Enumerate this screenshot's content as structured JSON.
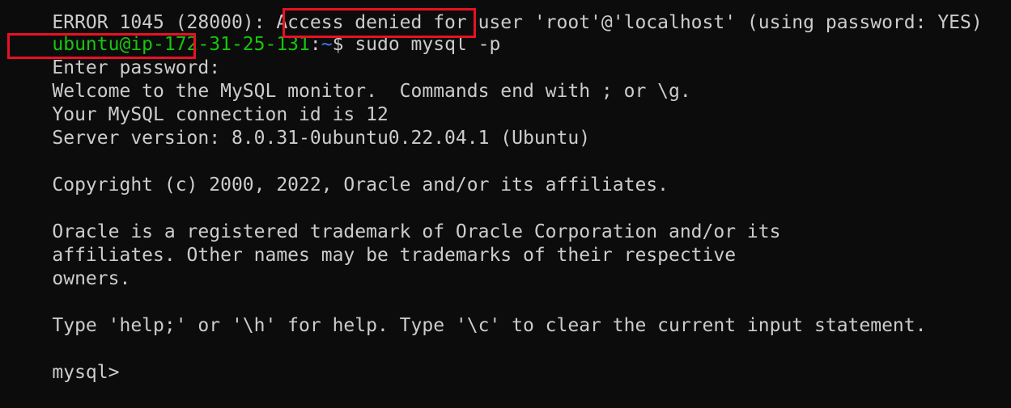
{
  "terminal": {
    "lines": {
      "error_partial": "ERROR 1045 (28000): Access denied for user 'root'@'localhost' (using password: YES)",
      "prompt_user_host": "ubuntu@ip-172-31-25-131",
      "prompt_colon": ":",
      "prompt_path": "~",
      "prompt_dollar": "$ ",
      "command": "sudo mysql -p",
      "enter_password": "Enter password:",
      "welcome": "Welcome to the MySQL monitor.  Commands end with ; or \\g.",
      "connection_id": "Your MySQL connection id is 12",
      "server_version": "Server version: 8.0.31-0ubuntu0.22.04.1 (Ubuntu)",
      "copyright": "Copyright (c) 2000, 2022, Oracle and/or its affiliates.",
      "trademark_1": "Oracle is a registered trademark of Oracle Corporation and/or its",
      "trademark_2": "affiliates. Other names may be trademarks of their respective",
      "trademark_3": "owners.",
      "help_hint": "Type 'help;' or '\\h' for help. Type '\\c' to clear the current input statement.",
      "mysql_prompt": "mysql>"
    },
    "colors": {
      "background": "#0c0c0c",
      "text": "#cccccc",
      "prompt_user": "#16c60c",
      "prompt_path": "#3b78ff",
      "annotation": "#e81123"
    }
  }
}
